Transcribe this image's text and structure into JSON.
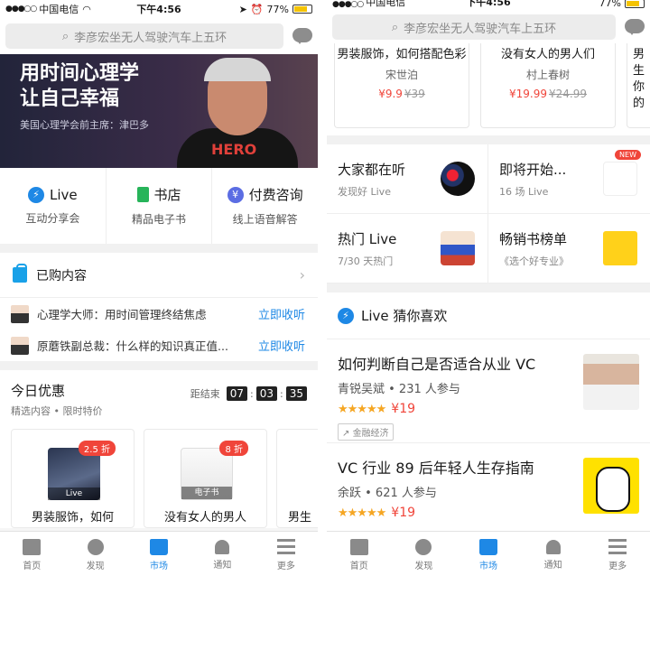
{
  "status": {
    "signal": "●●●○○",
    "carrier": "中国电信",
    "time": "下午4:56",
    "battery": "77%",
    "battery_level": 0.77
  },
  "search": {
    "placeholder": "李彦宏坐无人驾驶汽车上五环"
  },
  "banner": {
    "title_line1": "用时间心理学",
    "title_line2": "让自己幸福",
    "subtitle": "美国心理学会前主席：津巴多",
    "shirt_text": "HERO"
  },
  "quick": [
    {
      "title": "Live",
      "sub": "互动分享会"
    },
    {
      "title": "书店",
      "sub": "精品电子书"
    },
    {
      "title": "付费咨询",
      "sub": "线上语音解答"
    }
  ],
  "purchased": {
    "label": "已购内容"
  },
  "news": [
    {
      "text": "心理学大师：用时间管理终结焦虑",
      "link": "立即收听"
    },
    {
      "text": "原蘑铁副总裁：什么样的知识真正值...",
      "link": "立即收听"
    }
  ],
  "deals": {
    "title": "今日优惠",
    "sub": "精选内容 • 限时特价",
    "countdown_label": "距结束",
    "hh": "07",
    "mm": "03",
    "ss": "35",
    "cards": [
      {
        "tag": "Live",
        "discount": "2.5 折",
        "title": "男装服饰，如何"
      },
      {
        "tag": "电子书",
        "discount": "8 折",
        "title": "没有女人的男人"
      },
      {
        "title": "男生"
      }
    ]
  },
  "tabs": [
    "首页",
    "发现",
    "市场",
    "通知",
    "更多"
  ],
  "right": {
    "cards": [
      {
        "title": "男装服饰，如何搭配色彩",
        "author": "宋世泊",
        "price": "¥9.9",
        "old": "¥39"
      },
      {
        "title": "没有女人的男人们",
        "author": "村上春树",
        "price": "¥19.99",
        "old": "¥24.99"
      },
      {
        "title": "男生",
        "title2": "你的"
      }
    ],
    "grid": [
      {
        "title": "大家都在听",
        "sub": "发现好 Live"
      },
      {
        "title": "即将开始...",
        "sub": "16 场 Live",
        "badge": "NEW"
      },
      {
        "title": "热门 Live",
        "sub": "7/30 天热门"
      },
      {
        "title": "畅销书榜单",
        "sub": "《选个好专业》"
      }
    ],
    "section_title": "Live 猜你喜欢",
    "recs": [
      {
        "title": "如何判断自己是否适合从业 VC",
        "speaker": "青锐吴斌 • 231 人参与",
        "stars": "★★★★★",
        "price": "¥19",
        "tag": "金融经济"
      },
      {
        "title": "VC 行业 89 后年轻人生存指南",
        "speaker": "余跃 • 621 人参与",
        "stars": "★★★★★",
        "price": "¥19"
      }
    ]
  }
}
